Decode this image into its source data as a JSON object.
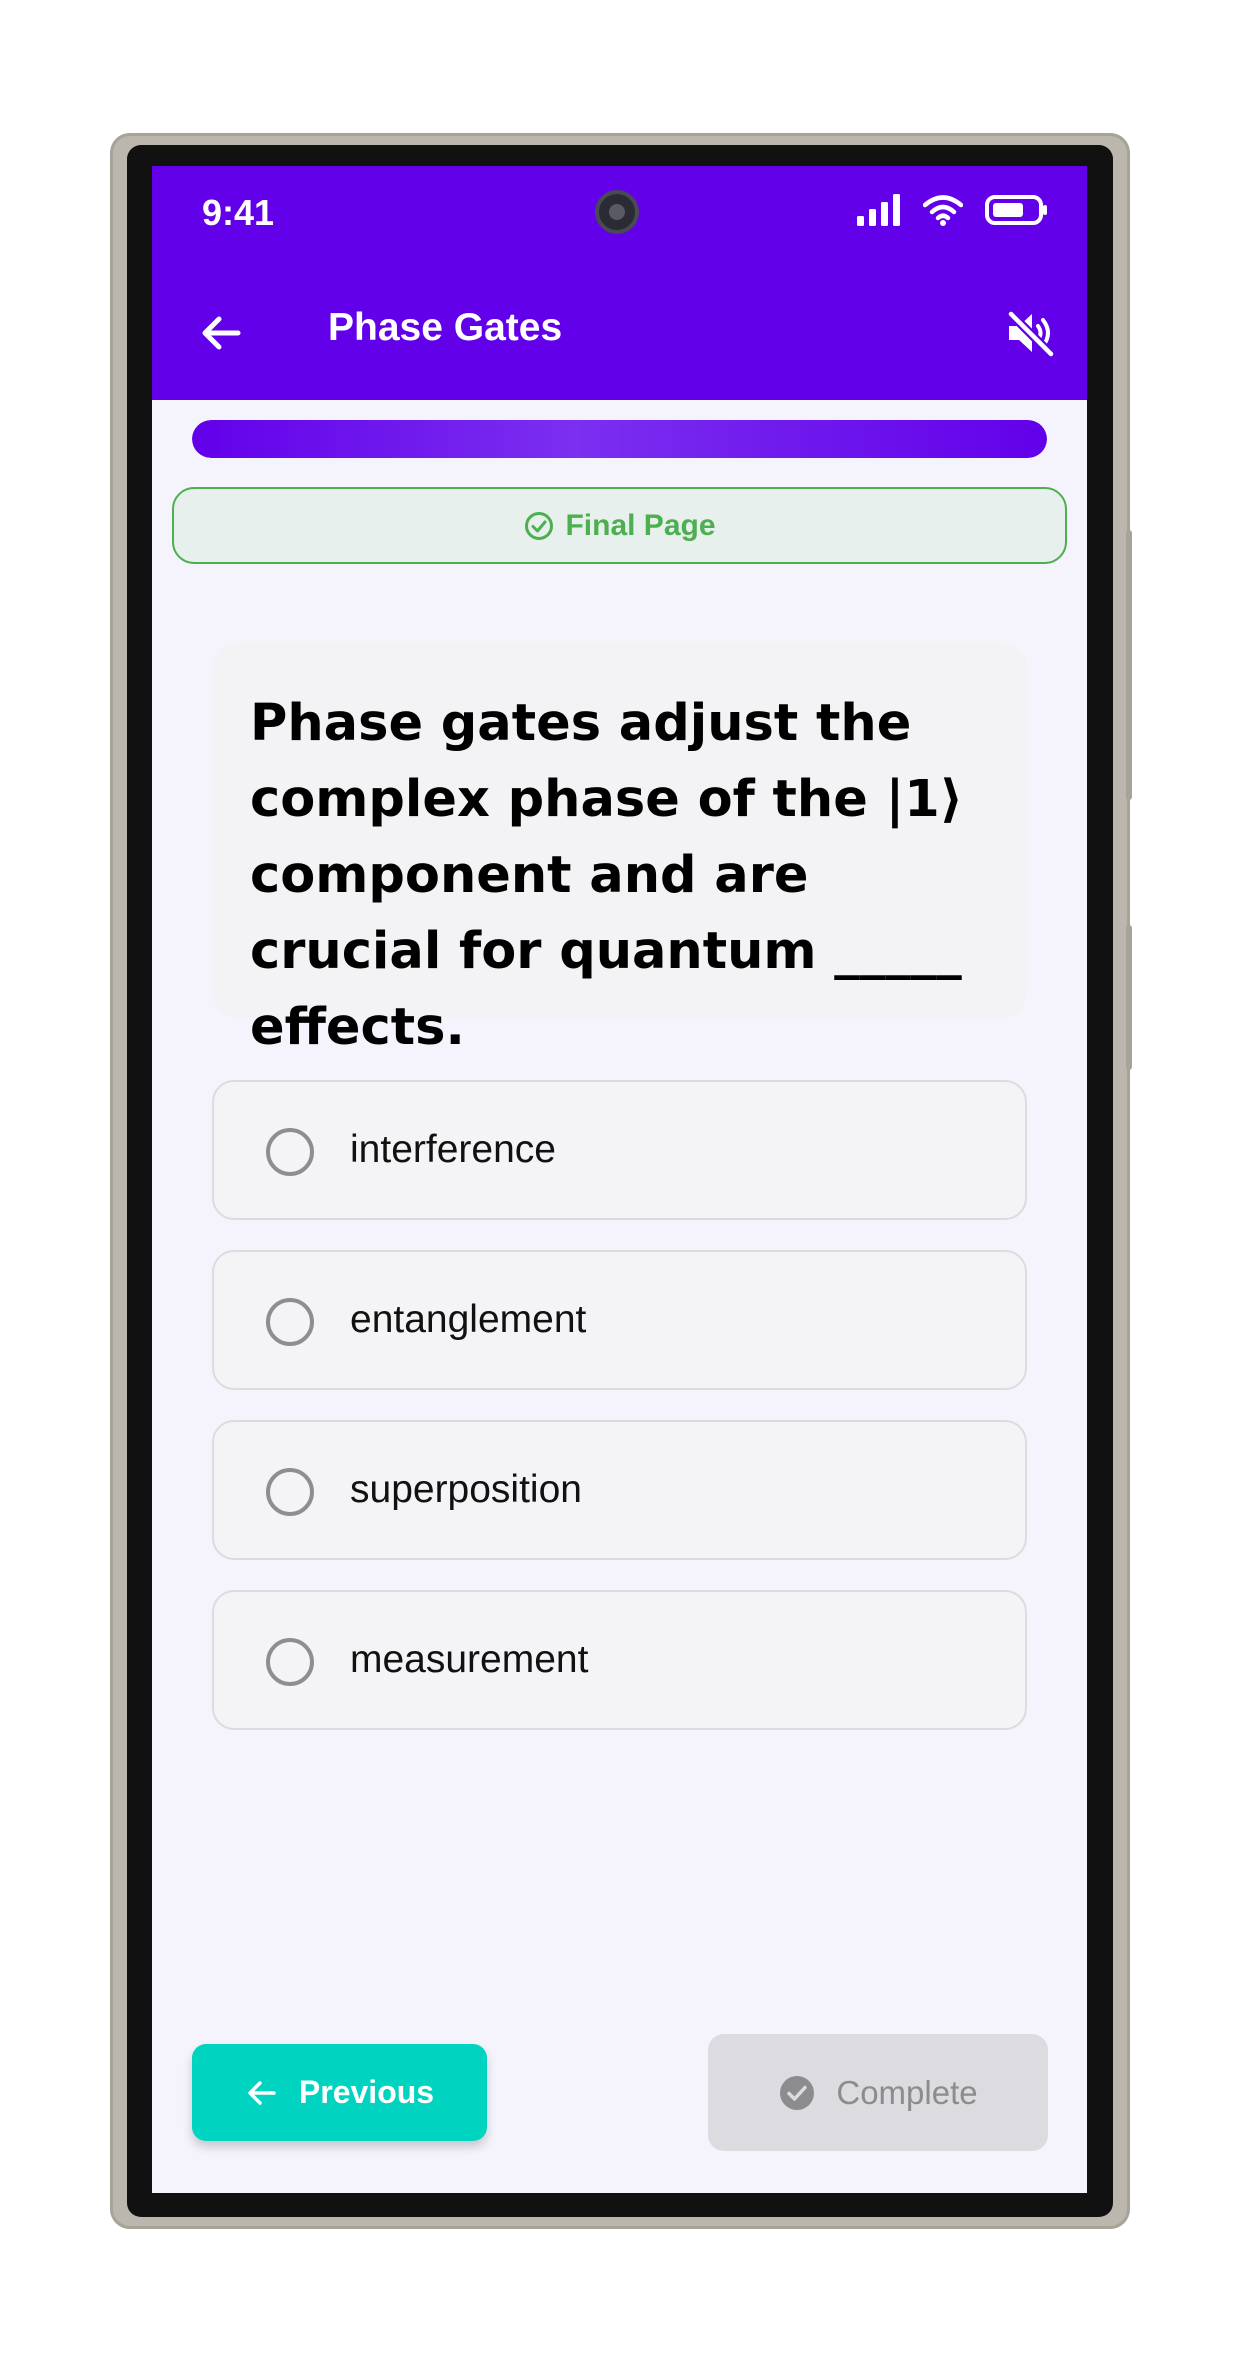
{
  "status_bar": {
    "time": "9:41",
    "icons": [
      "signal-icon",
      "wifi-icon",
      "battery-icon"
    ]
  },
  "header": {
    "back_icon": "arrow-left-icon",
    "title": "Phase Gates",
    "sound_icon": "volume-mute-icon",
    "background_color": "#6200ea"
  },
  "progress": {
    "value_percent": 100
  },
  "final_badge": {
    "icon": "check-circle-icon",
    "label": "Final Page",
    "color": "#4caf50"
  },
  "question": {
    "text": "Phase gates adjust the complex phase of the |1⟩ component and are crucial for quantum _____ effects."
  },
  "options": [
    {
      "label": "interference",
      "selected": false
    },
    {
      "label": "entanglement",
      "selected": false
    },
    {
      "label": "superposition",
      "selected": false
    },
    {
      "label": "measurement",
      "selected": false
    }
  ],
  "footer": {
    "previous_label": "Previous",
    "previous_color": "#00d4c0",
    "complete_label": "Complete",
    "complete_enabled": false
  }
}
